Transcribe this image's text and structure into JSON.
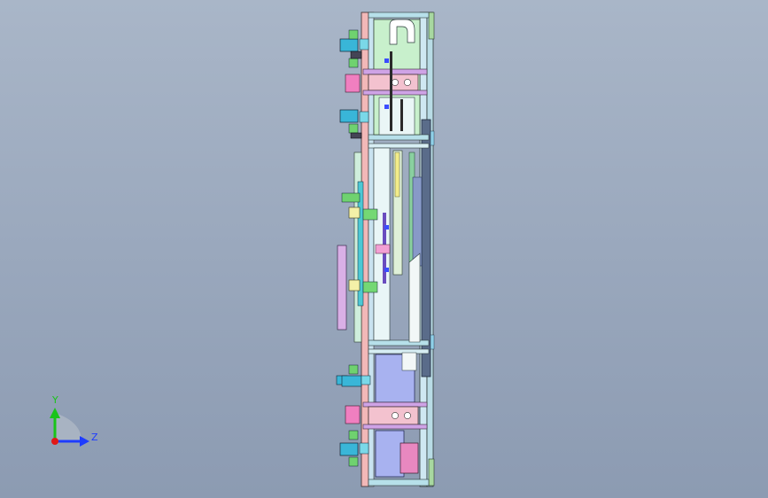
{
  "triad": {
    "y_label": "Y",
    "z_label": "Z",
    "colors": {
      "y": "#19c419",
      "z": "#1e3cff",
      "x": "#e01818"
    }
  },
  "viewport": {
    "background_top": "#a9b6c8",
    "background_bottom": "#8c9bb2"
  }
}
